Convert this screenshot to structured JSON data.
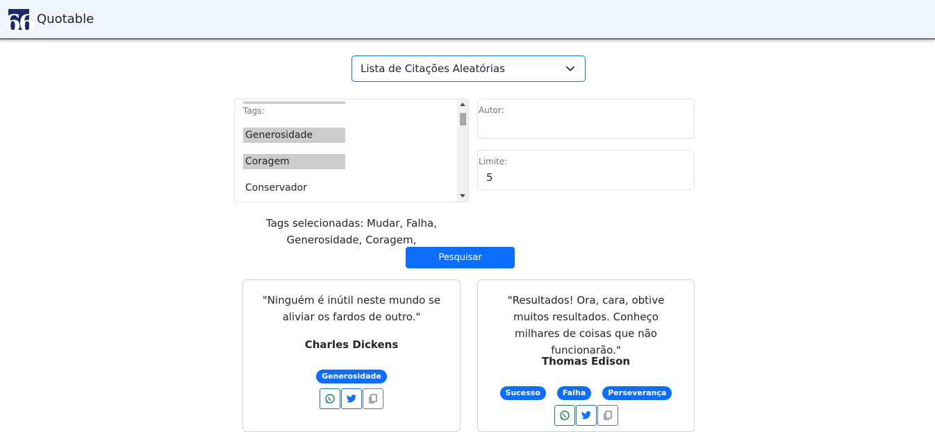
{
  "app": {
    "brand": "Quotable",
    "logo_glyph": "66"
  },
  "mode_select": {
    "value": "Lista de Citações Aleatórias",
    "options": [
      "Lista de Citações Aleatórias"
    ]
  },
  "tags_list": {
    "label": "Tags:",
    "options": [
      {
        "label": "Generosidade",
        "selected": true
      },
      {
        "label": "Coragem",
        "selected": true
      },
      {
        "label": "Conservador",
        "selected": false
      }
    ]
  },
  "author_field": {
    "label": "Autor:",
    "value": ""
  },
  "limit_field": {
    "label": "Limite:",
    "value": "5"
  },
  "selected_tags_text": "Tags selecionadas: Mudar, Falha, Generosidade, Coragem,",
  "search_button": "Pesquisar",
  "quotes": [
    {
      "text": "\"Ninguém é inútil neste mundo se aliviar os fardos de outro.\"",
      "author": "Charles Dickens",
      "tags": [
        "Generosidade"
      ]
    },
    {
      "text": "\"Resultados! Ora, cara, obtive muitos resultados. Conheço milhares de coisas que não funcionarão.\"",
      "author": "Thomas Edison",
      "tags": [
        "Sucesso",
        "Falha",
        "Perseverança"
      ]
    }
  ],
  "colors": {
    "primary": "#0d6efd",
    "navbar_bg": "#eef5fc",
    "logo_bg": "#1a2a6c",
    "whatsapp": "#198754"
  },
  "icons": {
    "whatsapp": "whatsapp-icon",
    "twitter": "twitter-icon",
    "copy": "copy-icon",
    "dropdown": "chevron-down-icon"
  }
}
